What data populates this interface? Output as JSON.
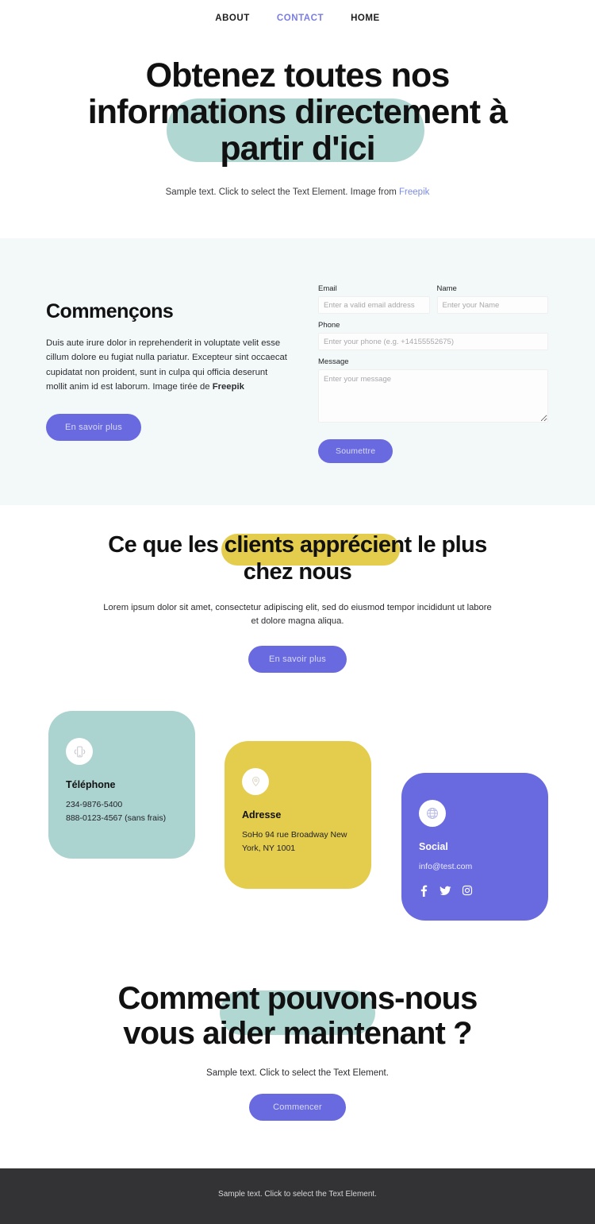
{
  "nav": {
    "items": [
      {
        "label": "ABOUT",
        "active": false
      },
      {
        "label": "CONTACT",
        "active": true
      },
      {
        "label": "HOME",
        "active": false
      }
    ]
  },
  "hero": {
    "title": "Obtenez toutes nos informations directement à partir d'ici",
    "subtitle_prefix": "Sample text. Click to select the Text Element. Image from ",
    "subtitle_link": "Freepik",
    "highlight_color": "#b1d7d2"
  },
  "form_section": {
    "background": "#f3f9f9",
    "title": "Commençons",
    "body_text": "Duis aute irure dolor in reprehenderit in voluptate velit esse cillum dolore eu fugiat nulla pariatur. Excepteur sint occaecat cupidatat non proident, sunt in culpa qui officia deserunt mollit anim id est laborum. Image tirée de ",
    "body_bold": "Freepik",
    "cta_label": "En savoir plus",
    "fields": {
      "email": {
        "label": "Email",
        "placeholder": "Enter a valid email address",
        "value": ""
      },
      "name": {
        "label": "Name",
        "placeholder": "Enter your Name",
        "value": ""
      },
      "phone": {
        "label": "Phone",
        "placeholder": "Enter your phone (e.g. +14155552675)",
        "value": ""
      },
      "message": {
        "label": "Message",
        "placeholder": "Enter your message",
        "value": ""
      }
    },
    "submit_label": "Soumettre"
  },
  "testimonials": {
    "title": "Ce que les clients apprécient le plus chez nous",
    "subtitle": "Lorem ipsum dolor sit amet, consectetur adipiscing elit, sed do eiusmod tempor incididunt ut labore et dolore magna aliqua.",
    "cta_label": "En savoir plus",
    "highlight_color": "#e4cc4d"
  },
  "cards": [
    {
      "id": "phone",
      "icon": "mobile-phone-icon",
      "title": "Téléphone",
      "line1": "234-9876-5400",
      "line2": "888-0123-4567 (sans frais)",
      "color": "#abd3cf"
    },
    {
      "id": "address",
      "icon": "location-pin-icon",
      "title": "Adresse",
      "line1": "SoHo 94 rue Broadway New",
      "line2": "York, NY 1001",
      "color": "#e4cc4d"
    },
    {
      "id": "social",
      "icon": "globe-icon",
      "title": "Social",
      "line1": "info@test.com",
      "color": "#6a6ae0",
      "socials": [
        "facebook-icon",
        "twitter-icon",
        "instagram-icon"
      ]
    }
  ],
  "cta": {
    "title": "Comment pouvons-nous vous aider maintenant ?",
    "subtitle": "Sample text. Click to select the Text Element.",
    "button_label": "Commencer",
    "highlight_color": "#b1d7d2"
  },
  "footer": {
    "text": "Sample text. Click to select the Text Element.",
    "background": "#333335"
  },
  "theme": {
    "accent_purple": "#6a6ae0",
    "accent_teal": "#abd3cf",
    "accent_yellow": "#e4cc4d",
    "text_dark": "#111112"
  }
}
